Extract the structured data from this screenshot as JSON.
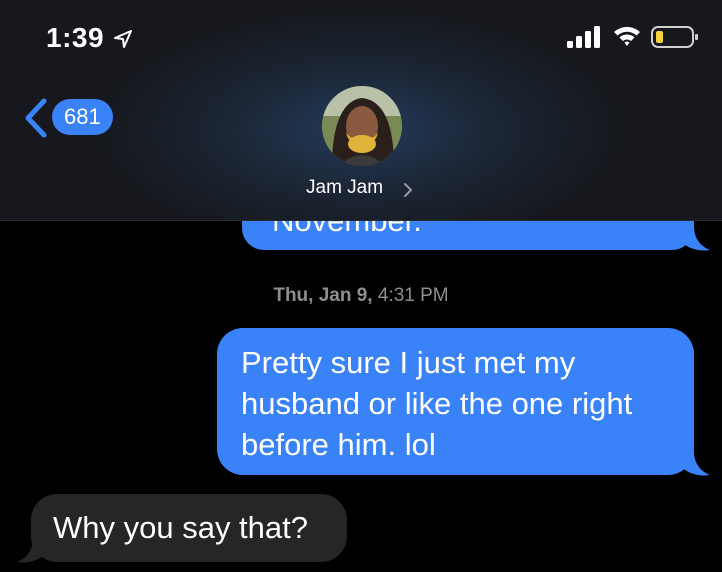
{
  "status_bar": {
    "time": "1:39",
    "icons": [
      "location-arrow-icon",
      "cellular-signal-icon",
      "wifi-icon",
      "battery-low-icon"
    ]
  },
  "nav": {
    "back_count": "681",
    "contact_name": "Jam Jam"
  },
  "messages": [
    {
      "direction": "outgoing",
      "text": "November.",
      "partial": true
    },
    {
      "type": "timestamp",
      "day": "Thu, Jan 9,",
      "time": "4:31 PM"
    },
    {
      "direction": "outgoing",
      "text": "Pretty sure I just met my husband or like the one right before him. lol"
    },
    {
      "direction": "incoming",
      "text": "Why you say that?"
    }
  ],
  "colors": {
    "outgoing_bubble": "#3a82f7",
    "incoming_bubble": "#262629",
    "timestamp_text": "#8d8d92",
    "battery_level": "#f5d33b"
  }
}
